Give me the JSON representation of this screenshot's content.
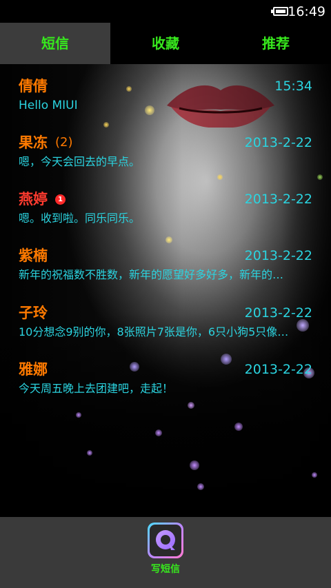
{
  "status_bar": {
    "time": "16:49"
  },
  "tabs": [
    {
      "label": "短信",
      "active": true
    },
    {
      "label": "收藏",
      "active": false
    },
    {
      "label": "推荐",
      "active": false
    }
  ],
  "messages": [
    {
      "name": "倩倩",
      "count": "",
      "unread": "",
      "date": "15:34",
      "preview": "Hello MIUI"
    },
    {
      "name": "果冻",
      "count": "(2)",
      "unread": "",
      "date": "2013-2-22",
      "preview": "嗯，今天会回去的早点。"
    },
    {
      "name": "燕婷",
      "count": "",
      "unread": "1",
      "date": "2013-2-22",
      "preview": "嗯。收到啦。同乐同乐。"
    },
    {
      "name": "紫楠",
      "count": "",
      "unread": "",
      "date": "2013-2-22",
      "preview": "新年的祝福数不胜数，新年的愿望好多好多，新年的…"
    },
    {
      "name": "子玲",
      "count": "",
      "unread": "",
      "date": "2013-2-22",
      "preview": "10分想念9别的你，8张照片7张是你，6只小狗5只像…"
    },
    {
      "name": "雅娜",
      "count": "",
      "unread": "",
      "date": "2013-2-22",
      "preview": "今天周五晚上去团建吧，走起！"
    }
  ],
  "bottom_bar": {
    "compose_label": "写短信",
    "compose_icon": "chat-bubble-icon"
  },
  "colors": {
    "tab_text": "#37e81d",
    "name_orange": "#ff7a00",
    "name_red": "#ff3b2f",
    "cyan_text": "#2bd4e0",
    "unread_badge": "#ff2a2a"
  }
}
